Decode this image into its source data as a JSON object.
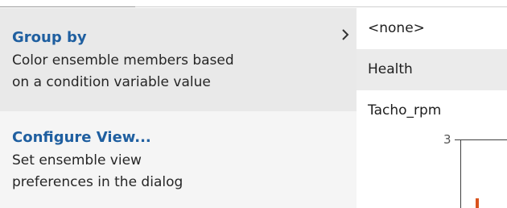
{
  "menu": {
    "items": [
      {
        "title": "Group by",
        "desc_line1": "Color ensemble members based",
        "desc_line2": "on a condition variable value",
        "has_submenu": true,
        "icon": "chevron-right-icon"
      },
      {
        "title": "Configure View...",
        "desc_line1": "Set ensemble view",
        "desc_line2": "preferences in the dialog"
      }
    ]
  },
  "submenu": {
    "items": [
      "<none>",
      "Health",
      "Tacho_rpm"
    ],
    "hovered_index": 1
  },
  "chart_fragment": {
    "tick_label": "3",
    "accent_color": "#d9531e"
  },
  "colors": {
    "title_blue": "#1f5fa0",
    "menu_bg": "#f5f5f5",
    "menu_hover_bg": "#e9e9e9",
    "submenu_hover_bg": "#ebebeb"
  }
}
